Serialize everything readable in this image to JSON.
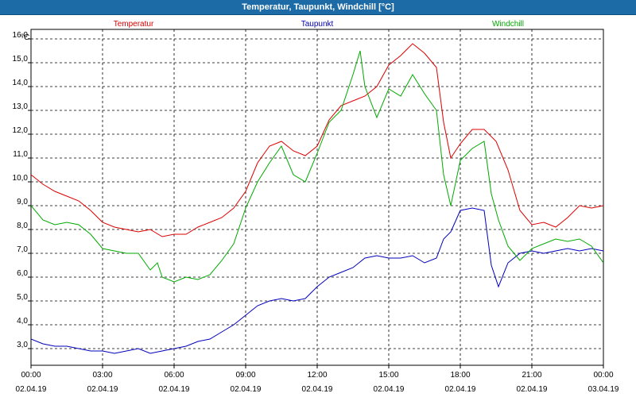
{
  "window": {
    "title": "Temperatur, Taupunkt, Windchill [°C]"
  },
  "chart_data": {
    "type": "line",
    "title": "Temperatur, Taupunkt, Windchill [°C]",
    "ylabel": "°C",
    "xlabel": "",
    "ylim": [
      2.3,
      16.4
    ],
    "xlim": [
      0,
      24
    ],
    "grid": true,
    "legend_placement": "top",
    "y_ticks": [
      "3,0",
      "4,0",
      "5,0",
      "6,0",
      "7,0",
      "8,0",
      "9,0",
      "10,0",
      "11,0",
      "12,0",
      "13,0",
      "14,0",
      "15,0",
      "16,0"
    ],
    "x_ticks": [
      {
        "time": "00:00",
        "date": "02.04.19"
      },
      {
        "time": "03:00",
        "date": "02.04.19"
      },
      {
        "time": "06:00",
        "date": "02.04.19"
      },
      {
        "time": "09:00",
        "date": "02.04.19"
      },
      {
        "time": "12:00",
        "date": "02.04.19"
      },
      {
        "time": "15:00",
        "date": "02.04.19"
      },
      {
        "time": "18:00",
        "date": "02.04.19"
      },
      {
        "time": "21:00",
        "date": "02.04.19"
      },
      {
        "time": "00:00",
        "date": "03.04.19"
      }
    ],
    "series": [
      {
        "name": "Temperatur",
        "color": "#dd0000",
        "points": [
          [
            0,
            10.3
          ],
          [
            0.5,
            9.9
          ],
          [
            1,
            9.6
          ],
          [
            1.5,
            9.4
          ],
          [
            2,
            9.2
          ],
          [
            2.5,
            8.8
          ],
          [
            3,
            8.3
          ],
          [
            3.5,
            8.1
          ],
          [
            4,
            8.0
          ],
          [
            4.5,
            7.9
          ],
          [
            5,
            8.0
          ],
          [
            5.5,
            7.7
          ],
          [
            6,
            7.8
          ],
          [
            6.5,
            7.8
          ],
          [
            7,
            8.1
          ],
          [
            7.5,
            8.3
          ],
          [
            8,
            8.5
          ],
          [
            8.5,
            8.9
          ],
          [
            9,
            9.6
          ],
          [
            9.5,
            10.8
          ],
          [
            10,
            11.5
          ],
          [
            10.5,
            11.7
          ],
          [
            11,
            11.3
          ],
          [
            11.5,
            11.1
          ],
          [
            12,
            11.5
          ],
          [
            12.5,
            12.6
          ],
          [
            13,
            13.2
          ],
          [
            13.5,
            13.4
          ],
          [
            14,
            13.6
          ],
          [
            14.5,
            14.0
          ],
          [
            15,
            14.9
          ],
          [
            15.5,
            15.3
          ],
          [
            16,
            15.8
          ],
          [
            16.5,
            15.4
          ],
          [
            17,
            14.8
          ],
          [
            17.3,
            12.5
          ],
          [
            17.6,
            11.0
          ],
          [
            18,
            11.6
          ],
          [
            18.5,
            12.2
          ],
          [
            19,
            12.2
          ],
          [
            19.5,
            11.7
          ],
          [
            20,
            10.5
          ],
          [
            20.5,
            8.8
          ],
          [
            21,
            8.2
          ],
          [
            21.5,
            8.3
          ],
          [
            22,
            8.1
          ],
          [
            22.5,
            8.5
          ],
          [
            23,
            9.0
          ],
          [
            23.5,
            8.9
          ],
          [
            24,
            9.0
          ]
        ]
      },
      {
        "name": "Taupunkt",
        "color": "#0000bb",
        "points": [
          [
            0,
            3.4
          ],
          [
            0.5,
            3.2
          ],
          [
            1,
            3.1
          ],
          [
            1.5,
            3.1
          ],
          [
            2,
            3.0
          ],
          [
            2.5,
            2.9
          ],
          [
            3,
            2.9
          ],
          [
            3.5,
            2.8
          ],
          [
            4,
            2.9
          ],
          [
            4.5,
            3.0
          ],
          [
            5,
            2.8
          ],
          [
            5.5,
            2.9
          ],
          [
            6,
            3.0
          ],
          [
            6.5,
            3.1
          ],
          [
            7,
            3.3
          ],
          [
            7.5,
            3.4
          ],
          [
            8,
            3.7
          ],
          [
            8.5,
            4.0
          ],
          [
            9,
            4.4
          ],
          [
            9.5,
            4.8
          ],
          [
            10,
            5.0
          ],
          [
            10.5,
            5.1
          ],
          [
            11,
            5.0
          ],
          [
            11.5,
            5.1
          ],
          [
            12,
            5.6
          ],
          [
            12.5,
            6.0
          ],
          [
            13,
            6.2
          ],
          [
            13.5,
            6.4
          ],
          [
            14,
            6.8
          ],
          [
            14.5,
            6.9
          ],
          [
            15,
            6.8
          ],
          [
            15.5,
            6.8
          ],
          [
            16,
            6.9
          ],
          [
            16.5,
            6.6
          ],
          [
            17,
            6.8
          ],
          [
            17.3,
            7.6
          ],
          [
            17.6,
            7.9
          ],
          [
            18,
            8.8
          ],
          [
            18.5,
            8.9
          ],
          [
            19,
            8.8
          ],
          [
            19.3,
            6.5
          ],
          [
            19.6,
            5.6
          ],
          [
            20,
            6.6
          ],
          [
            20.5,
            7.0
          ],
          [
            21,
            7.1
          ],
          [
            21.5,
            7.0
          ],
          [
            22,
            7.1
          ],
          [
            22.5,
            7.2
          ],
          [
            23,
            7.1
          ],
          [
            23.5,
            7.2
          ],
          [
            24,
            7.1
          ]
        ]
      },
      {
        "name": "Windchill",
        "color": "#00aa00",
        "points": [
          [
            0,
            9.0
          ],
          [
            0.5,
            8.4
          ],
          [
            1,
            8.2
          ],
          [
            1.5,
            8.3
          ],
          [
            2,
            8.2
          ],
          [
            2.5,
            7.8
          ],
          [
            3,
            7.2
          ],
          [
            3.5,
            7.1
          ],
          [
            4,
            7.0
          ],
          [
            4.5,
            7.0
          ],
          [
            5,
            6.3
          ],
          [
            5.3,
            6.6
          ],
          [
            5.5,
            6.0
          ],
          [
            6,
            5.8
          ],
          [
            6.5,
            6.0
          ],
          [
            7,
            5.9
          ],
          [
            7.5,
            6.1
          ],
          [
            8,
            6.7
          ],
          [
            8.5,
            7.4
          ],
          [
            9,
            8.9
          ],
          [
            9.5,
            10.0
          ],
          [
            10,
            10.8
          ],
          [
            10.5,
            11.5
          ],
          [
            11,
            10.3
          ],
          [
            11.5,
            10.0
          ],
          [
            12,
            11.2
          ],
          [
            12.5,
            12.5
          ],
          [
            13,
            13.0
          ],
          [
            13.5,
            14.5
          ],
          [
            13.8,
            15.5
          ],
          [
            14,
            14.0
          ],
          [
            14.5,
            12.7
          ],
          [
            15,
            13.9
          ],
          [
            15.5,
            13.6
          ],
          [
            16,
            14.5
          ],
          [
            16.5,
            13.7
          ],
          [
            17,
            13.0
          ],
          [
            17.3,
            10.3
          ],
          [
            17.6,
            9.0
          ],
          [
            18,
            10.9
          ],
          [
            18.5,
            11.4
          ],
          [
            19,
            11.7
          ],
          [
            19.3,
            9.5
          ],
          [
            19.6,
            8.4
          ],
          [
            20,
            7.3
          ],
          [
            20.5,
            6.7
          ],
          [
            21,
            7.2
          ],
          [
            21.5,
            7.4
          ],
          [
            22,
            7.6
          ],
          [
            22.5,
            7.5
          ],
          [
            23,
            7.6
          ],
          [
            23.5,
            7.3
          ],
          [
            24,
            6.6
          ]
        ]
      }
    ]
  }
}
